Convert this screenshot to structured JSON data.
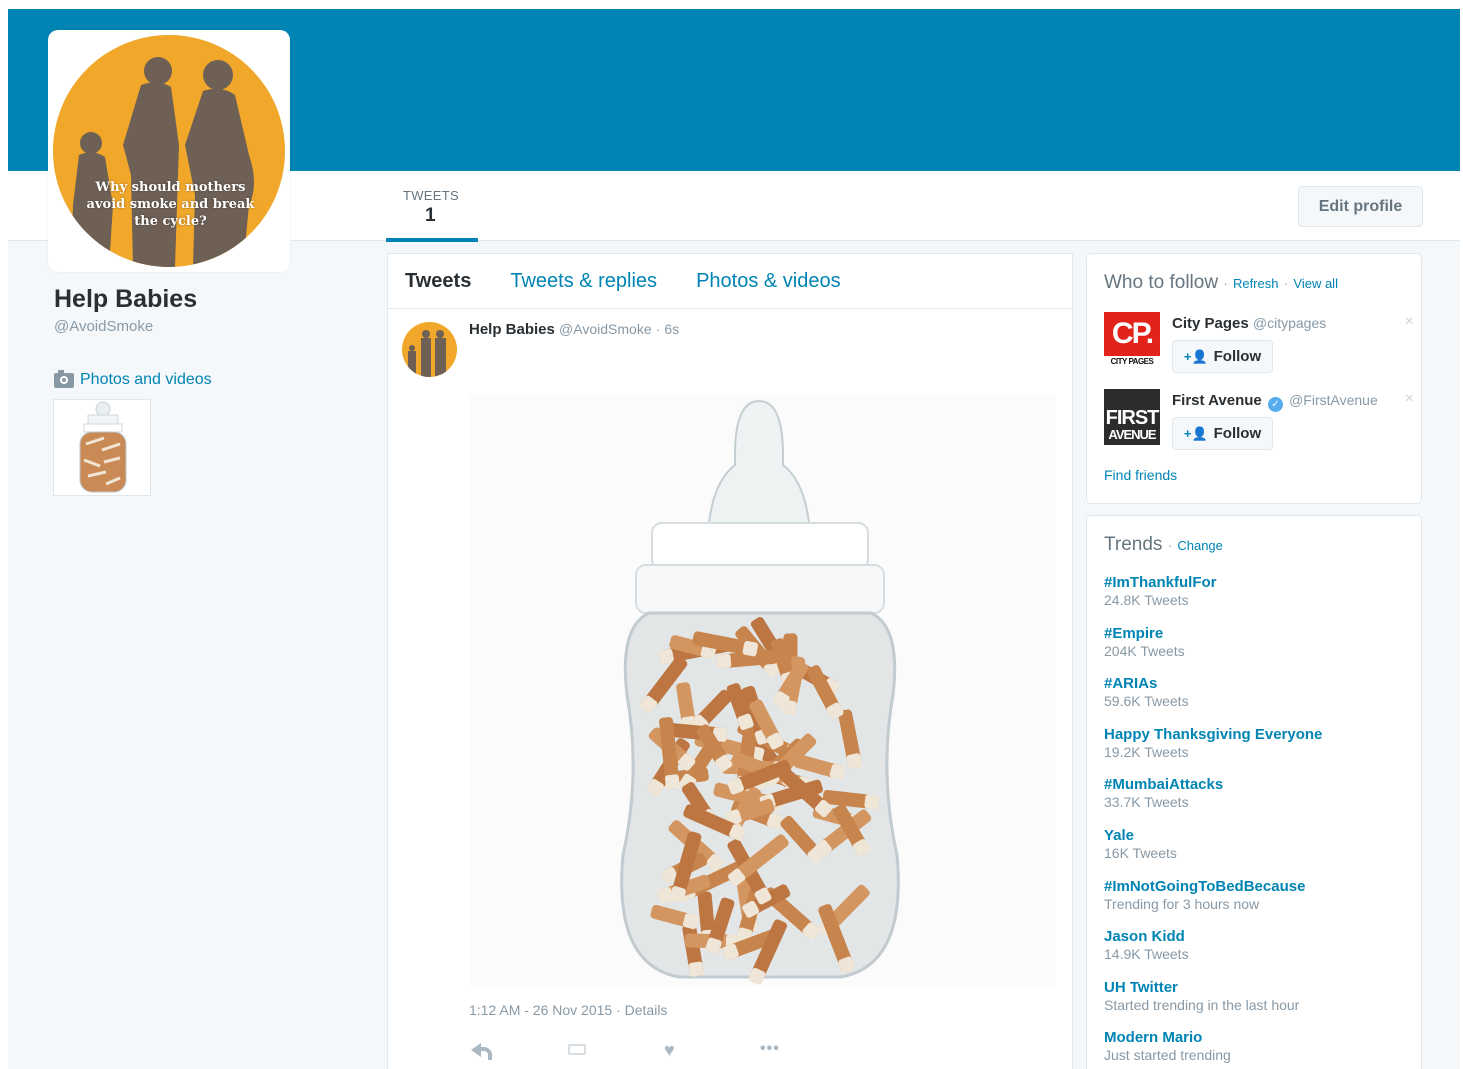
{
  "colors": {
    "brand": "#0084b4",
    "avatar_bg": "#f0a72a"
  },
  "profile": {
    "name": "Help Babies",
    "handle": "@AvoidSmoke",
    "avatar_text": "Why should mothers avoid smoke and break the cycle?",
    "photos_videos_label": "Photos and videos"
  },
  "stats": {
    "tweets_label": "TWEETS",
    "tweets_value": "1"
  },
  "edit_profile_label": "Edit profile",
  "tabs": [
    {
      "label": "Tweets"
    },
    {
      "label": "Tweets & replies"
    },
    {
      "label": "Photos & videos"
    }
  ],
  "tweet": {
    "name": "Help Babies",
    "handle": "@AvoidSmoke",
    "age": "· 6s",
    "timestamp": "1:12 AM - 26 Nov 2015 · Details",
    "more_label": "•••"
  },
  "who_to_follow": {
    "title": "Who to follow",
    "sep1": "·",
    "refresh": "Refresh",
    "sep2": "·",
    "view_all": "View all",
    "suggestions": [
      {
        "name": "City Pages",
        "handle": "@citypages",
        "avatar_big": "CP.",
        "avatar_small": "CITY PAGES",
        "follow": "Follow",
        "close": "×"
      },
      {
        "name": "First Avenue",
        "handle": "@FirstAvenue",
        "avatar_big": "FIRST",
        "avatar_small": "AVENUE",
        "follow": "Follow",
        "close": "×",
        "verified": "✓"
      }
    ],
    "find_friends": "Find friends"
  },
  "trends": {
    "title": "Trends",
    "sep": "·",
    "change": "Change",
    "items": [
      {
        "name": "#ImThankfulFor",
        "sub": "24.8K Tweets"
      },
      {
        "name": "#Empire",
        "sub": "204K Tweets"
      },
      {
        "name": "#ARIAs",
        "sub": "59.6K Tweets"
      },
      {
        "name": "Happy Thanksgiving Everyone",
        "sub": "19.2K Tweets"
      },
      {
        "name": "#MumbaiAttacks",
        "sub": "33.7K Tweets"
      },
      {
        "name": "Yale",
        "sub": "16K Tweets"
      },
      {
        "name": "#ImNotGoingToBedBecause",
        "sub": "Trending for 3 hours now"
      },
      {
        "name": "Jason Kidd",
        "sub": "14.9K Tweets"
      },
      {
        "name": "UH Twitter",
        "sub": "Started trending in the last hour"
      },
      {
        "name": "Modern Mario",
        "sub": "Just started trending"
      }
    ]
  }
}
